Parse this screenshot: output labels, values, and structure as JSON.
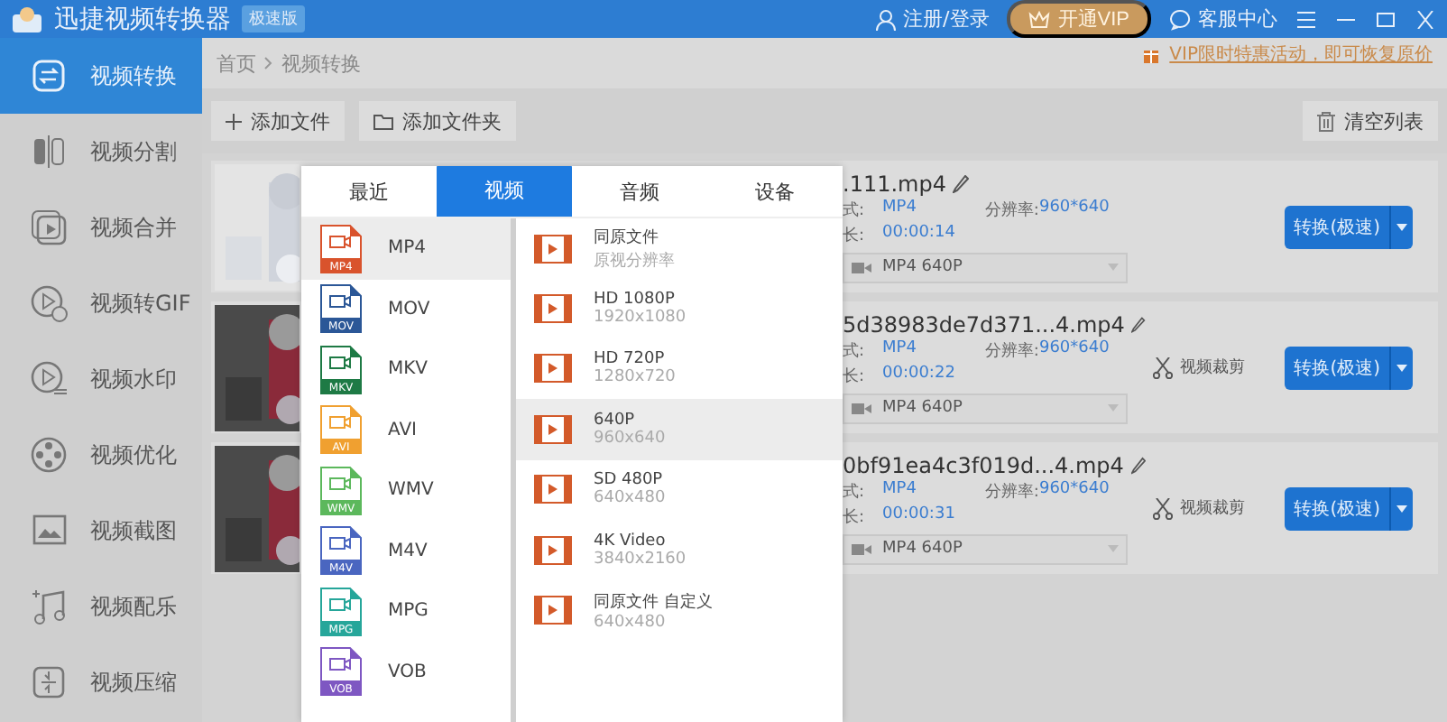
{
  "app": {
    "title": "迅捷视频转换器",
    "edition": "极速版",
    "login": "注册/登录",
    "vip": "开通VIP",
    "support": "客服中心"
  },
  "sidebar": {
    "items": [
      {
        "label": "视频转换",
        "kind": "convert",
        "selected": true
      },
      {
        "label": "视频分割",
        "kind": "split",
        "selected": false
      },
      {
        "label": "视频合并",
        "kind": "merge",
        "selected": false
      },
      {
        "label": "视频转GIF",
        "kind": "gif",
        "selected": false
      },
      {
        "label": "视频水印",
        "kind": "watermark",
        "selected": false
      },
      {
        "label": "视频优化",
        "kind": "optimize",
        "selected": false
      },
      {
        "label": "视频截图",
        "kind": "screenshot",
        "selected": false
      },
      {
        "label": "视频配乐",
        "kind": "music",
        "selected": false
      },
      {
        "label": "视频压缩",
        "kind": "compress",
        "selected": false
      }
    ]
  },
  "breadcrumb": [
    "首页",
    "视频转换"
  ],
  "promo": "VIP限时特惠活动，即可恢复原价",
  "toolbar": {
    "add_file": "添加文件",
    "add_folder": "添加文件夹",
    "clear": "清空列表"
  },
  "files": [
    {
      "name": ".111.mp4",
      "format_label": "式:",
      "format": "MP4",
      "resolution_label": "分辨率:",
      "resolution": "960*640",
      "duration_label": "长:",
      "duration": "00:00:14",
      "output": "MP4  640P",
      "convert": "转换(极速)"
    },
    {
      "name": "5d38983de7d371...4.mp4",
      "format_label": "式:",
      "format": "MP4",
      "resolution_label": "分辨率:",
      "resolution": "960*640",
      "duration_label": "长:",
      "duration": "00:00:22",
      "output": "MP4  640P",
      "trim": "视频裁剪",
      "convert": "转换(极速)"
    },
    {
      "name": "0bf91ea4c3f019d...4.mp4",
      "format_label": "式:",
      "format": "MP4",
      "resolution_label": "分辨率:",
      "resolution": "960*640",
      "duration_label": "长:",
      "duration": "00:00:31",
      "output": "MP4  640P",
      "trim": "视频裁剪",
      "convert": "转换(极速)"
    }
  ],
  "format_popup": {
    "tabs": [
      {
        "label": "最近",
        "selected": false
      },
      {
        "label": "视频",
        "selected": true
      },
      {
        "label": "音频",
        "selected": false
      },
      {
        "label": "设备",
        "selected": false
      }
    ],
    "formats": [
      {
        "label": "MP4",
        "badge": "MP4",
        "color": "#d9532c",
        "selected": true
      },
      {
        "label": "MOV",
        "badge": "MOV",
        "color": "#2b5797",
        "selected": false
      },
      {
        "label": "MKV",
        "badge": "MKV",
        "color": "#1e7a45",
        "selected": false
      },
      {
        "label": "AVI",
        "badge": "AVI",
        "color": "#f0a030",
        "selected": false
      },
      {
        "label": "WMV",
        "badge": "WMV",
        "color": "#5cb85c",
        "selected": false
      },
      {
        "label": "M4V",
        "badge": "M4V",
        "color": "#4a66c0",
        "selected": false
      },
      {
        "label": "MPG",
        "badge": "MPG",
        "color": "#26a69a",
        "selected": false
      },
      {
        "label": "VOB",
        "badge": "VOB",
        "color": "#7e57c2",
        "selected": false
      }
    ],
    "presets": [
      {
        "title": "同原文件",
        "subtitle": "原视分辨率",
        "selected": false
      },
      {
        "title": "HD 1080P",
        "subtitle": "1920x1080",
        "selected": false
      },
      {
        "title": "HD 720P",
        "subtitle": "1280x720",
        "selected": false
      },
      {
        "title": "640P",
        "subtitle": "960x640",
        "selected": true
      },
      {
        "title": "SD 480P",
        "subtitle": "640x480",
        "selected": false
      },
      {
        "title": "4K Video",
        "subtitle": "3840x2160",
        "selected": false
      },
      {
        "title": "同原文件 自定义",
        "subtitle": "640x480",
        "selected": false
      }
    ]
  }
}
